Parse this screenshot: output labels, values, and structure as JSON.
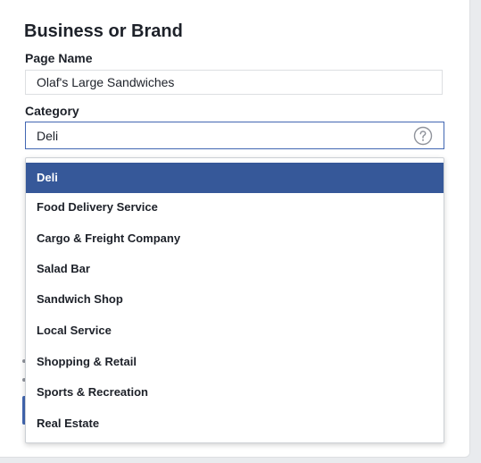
{
  "section": {
    "title": "Business or Brand"
  },
  "page_name": {
    "label": "Page Name",
    "value": "Olaf's Large Sandwiches"
  },
  "category": {
    "label": "Category",
    "value": "Deli",
    "help_icon": "question-circle-icon"
  },
  "dropdown": {
    "options": [
      {
        "label": "Deli",
        "selected": true
      },
      {
        "label": "Food Delivery Service",
        "selected": false
      },
      {
        "label": "Cargo & Freight Company",
        "selected": false
      },
      {
        "label": "Salad Bar",
        "selected": false
      },
      {
        "label": "Sandwich Shop",
        "selected": false
      },
      {
        "label": "Local Service",
        "selected": false
      },
      {
        "label": "Shopping & Retail",
        "selected": false
      },
      {
        "label": "Sports & Recreation",
        "selected": false
      },
      {
        "label": "Real Estate",
        "selected": false
      }
    ]
  },
  "colors": {
    "accent": "#365899",
    "focus_border": "#4267b2",
    "text": "#1d2129"
  }
}
